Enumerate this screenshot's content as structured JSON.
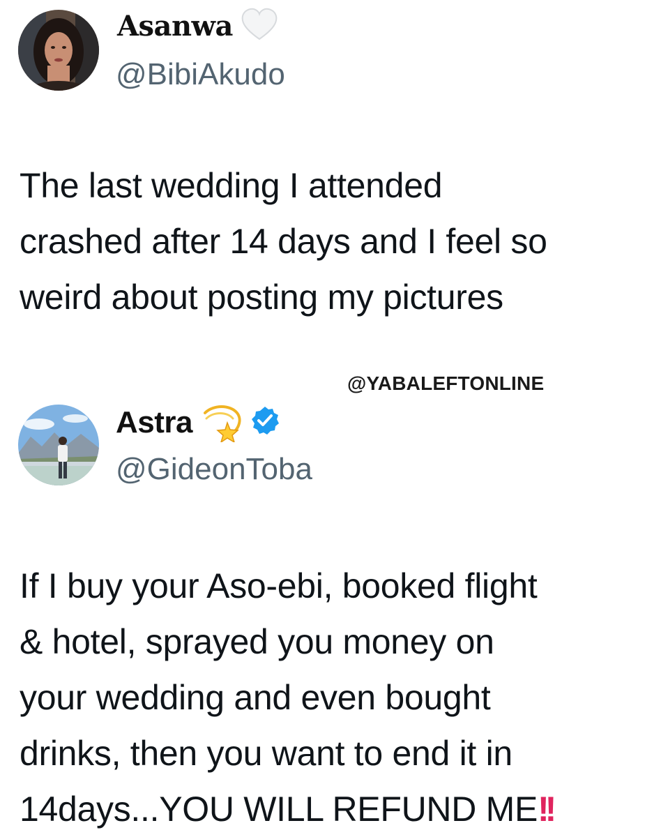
{
  "tweets": [
    {
      "display_name": "Asanwa",
      "name_icon": "white-heart-icon",
      "handle": "@BibiAkudo",
      "text": "The last wedding I attended\ncrashed after 14 days and I feel so\nweird about posting my pictures"
    },
    {
      "display_name": "Astra",
      "name_icon": "dizzy-star-icon",
      "verified_icon": "verified-badge-icon",
      "handle": "@GideonToba",
      "text": "If I buy your Aso-ebi, booked flight\n& hotel, sprayed you money on\nyour wedding and even bought\ndrinks, then you want to end it in\n14days...YOU WILL REFUND ME",
      "trailing_icon": "double-exclamation-icon",
      "trailing_glyph": "!!"
    }
  ],
  "watermark": "@YABALEFTONLINE",
  "colors": {
    "text": "#0f1419",
    "handle": "#536471",
    "verified": "#1d9bf0",
    "alert": "#e0245e"
  }
}
